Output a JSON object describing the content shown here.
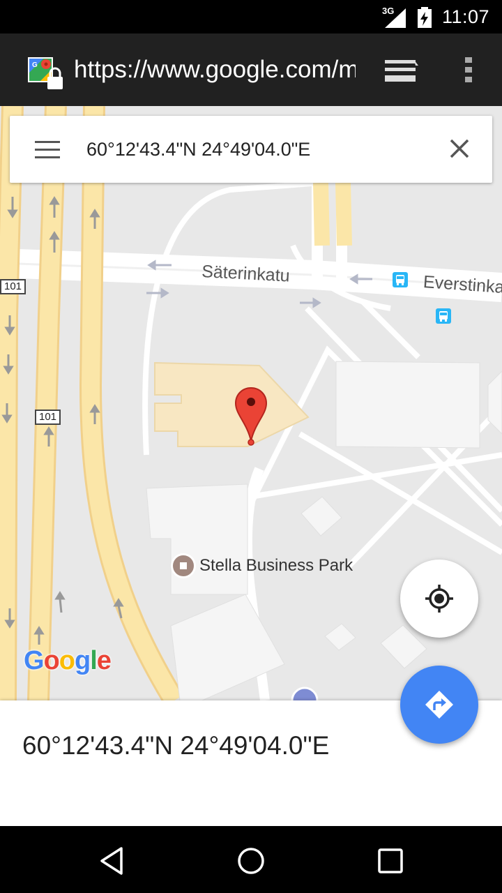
{
  "status_bar": {
    "network": "3G",
    "time": "11:07"
  },
  "browser": {
    "url": "https://www.google.com/maps",
    "site_icon": "google-maps-lock-icon",
    "tabs_icon": "tab-switcher-icon",
    "menu_icon": "overflow-menu-icon"
  },
  "search": {
    "value": "60°12'43.4\"N 24°49'04.0\"E",
    "menu_icon": "hamburger-menu-icon",
    "clear_icon": "close-icon"
  },
  "map": {
    "street_1": "Säterinkatu",
    "street_2": "Everstinkatu",
    "highway_shield_1": "101",
    "highway_shield_2": "101",
    "poi_name": "Stella Business Park",
    "logo": "Google",
    "colors": {
      "background": "#e8e8e8",
      "highway": "#fbe6a8",
      "building": "#f5f5f5",
      "highlighted_building": "#f8e7c2",
      "pin": "#ea4335",
      "transit": "#29b6f6"
    }
  },
  "fab": {
    "my_location_icon": "my-location-icon",
    "directions_icon": "directions-icon",
    "directions_color": "#4285f4"
  },
  "place_sheet": {
    "title": "60°12'43.4\"N 24°49'04.0\"E"
  },
  "nav": {
    "back_icon": "back-icon",
    "home_icon": "home-icon",
    "recents_icon": "recents-icon"
  }
}
